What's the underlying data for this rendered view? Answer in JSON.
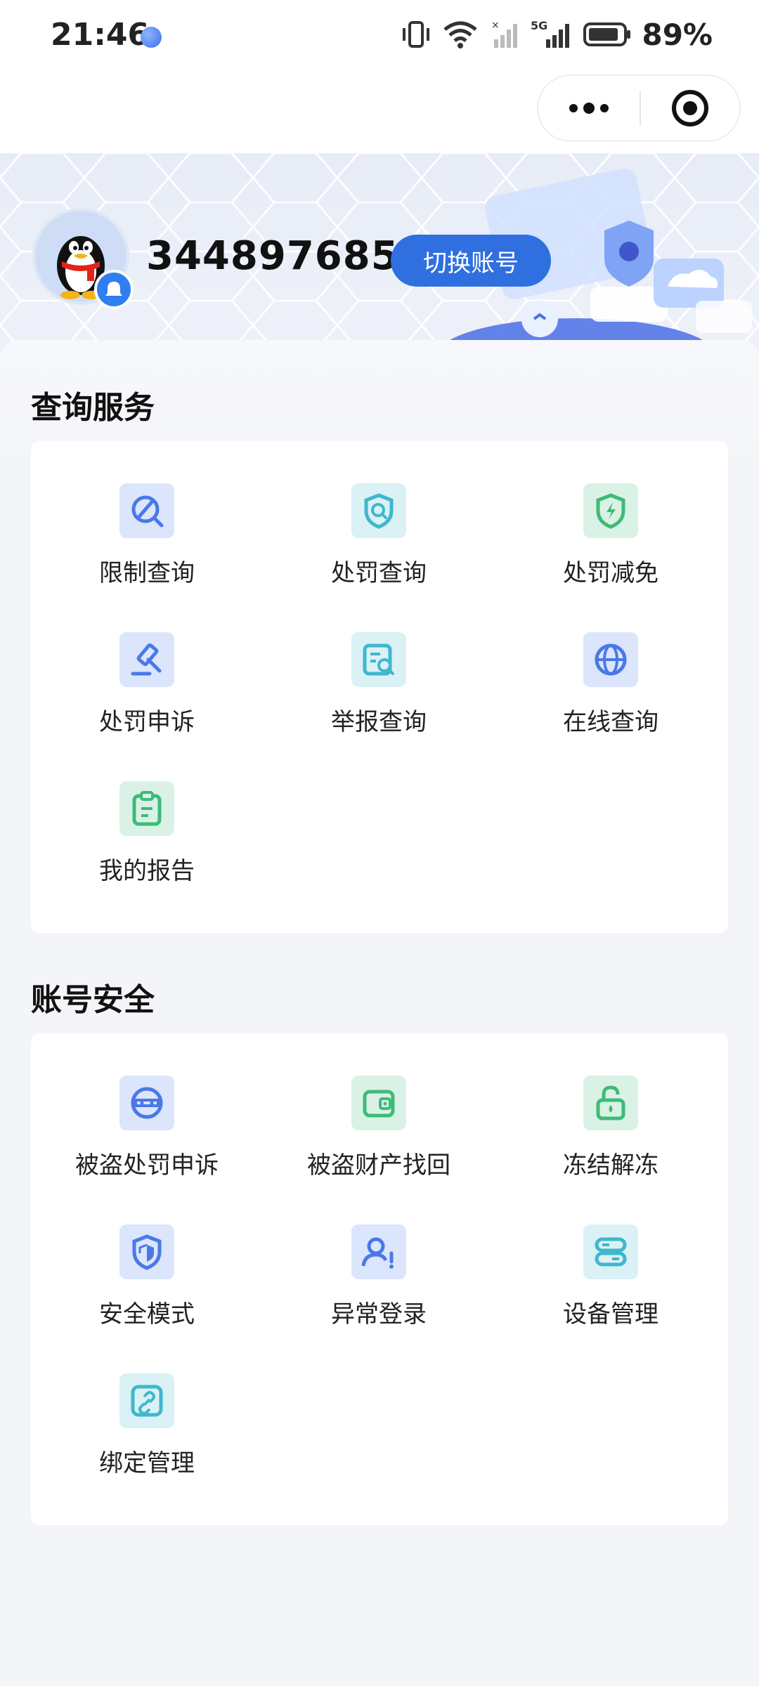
{
  "status_bar": {
    "time": "21:46",
    "battery_percent": "89%",
    "network": "5G",
    "battery_level": 0.89
  },
  "header": {
    "account_id": "3448976859",
    "switch_button": "切换账号"
  },
  "sections": [
    {
      "title": "查询服务",
      "items": [
        {
          "label": "限制查询",
          "icon": "restrict-search-icon",
          "color": "#4a78e8"
        },
        {
          "label": "处罚查询",
          "icon": "penalty-search-icon",
          "color": "#3fb7cc"
        },
        {
          "label": "处罚减免",
          "icon": "penalty-reduction-icon",
          "color": "#3dbb78"
        },
        {
          "label": "处罚申诉",
          "icon": "gavel-icon",
          "color": "#4a78e8"
        },
        {
          "label": "举报查询",
          "icon": "report-search-icon",
          "color": "#3fb7cc"
        },
        {
          "label": "在线查询",
          "icon": "globe-icon",
          "color": "#4a78e8"
        },
        {
          "label": "我的报告",
          "icon": "clipboard-icon",
          "color": "#3dbb78"
        }
      ]
    },
    {
      "title": "账号安全",
      "items": [
        {
          "label": "被盗处罚申诉",
          "icon": "masked-user-icon",
          "color": "#4a78e8"
        },
        {
          "label": "被盗财产找回",
          "icon": "wallet-icon",
          "color": "#3dbb78"
        },
        {
          "label": "冻结解冻",
          "icon": "unlock-icon",
          "color": "#3dbb78"
        },
        {
          "label": "安全模式",
          "icon": "shield-icon",
          "color": "#4a78e8"
        },
        {
          "label": "异常登录",
          "icon": "user-alert-icon",
          "color": "#4a78e8"
        },
        {
          "label": "设备管理",
          "icon": "device-icon",
          "color": "#3fb7cc"
        },
        {
          "label": "绑定管理",
          "icon": "link-icon",
          "color": "#3fb7cc"
        }
      ]
    }
  ]
}
